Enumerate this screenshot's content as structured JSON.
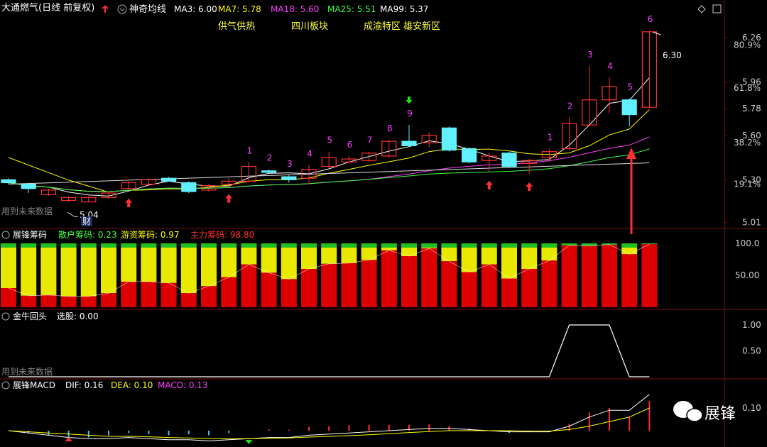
{
  "panel_main": {
    "stock_title": "大通燃气(日线 前复权)",
    "indicator_name": "神奇均线",
    "ma_labels": [
      {
        "label": "MA3: 6.00",
        "color": "#ffffff"
      },
      {
        "label": "MA7: 5.78",
        "color": "#ffff00"
      },
      {
        "label": "MA18: 5.60",
        "color": "#ff40ff"
      },
      {
        "label": "MA25: 5.51",
        "color": "#40ff40"
      },
      {
        "label": "MA99: 5.37",
        "color": "#ffffff"
      }
    ],
    "annotations": [
      "供气供热",
      "四川板块",
      "成渝特区 雄安新区"
    ],
    "future_note": "用到未来数据",
    "low_label": "5.04",
    "high_label": "6.30",
    "cai_label": "财",
    "price_ticks": [
      "6.26",
      "5.96",
      "5.78",
      "5.60",
      "5.30",
      "5.01"
    ],
    "pct_ticks": [
      "80.9%",
      "61.8%",
      "38.2%",
      "19.1%"
    ],
    "count_labels": [
      "1",
      "2",
      "3",
      "4",
      "5",
      "6",
      "7",
      "8",
      "9",
      "1",
      "2",
      "3",
      "4",
      "5",
      "6"
    ]
  },
  "panel_chip": {
    "name": "展锋筹码",
    "labels": [
      {
        "text": "散户筹码: 0.23",
        "color": "#40ff40"
      },
      {
        "text": "游资筹码: 0.97",
        "color": "#ffff00"
      },
      {
        "text": "主力筹码: 98.80",
        "color": "#ff3030"
      }
    ],
    "ticks": [
      "100.0",
      "50.00"
    ]
  },
  "panel_bull": {
    "name": "金牛回头",
    "label": "选股: 0.00",
    "note": "用到未来数据",
    "ticks": [
      "1.00",
      "0.50"
    ]
  },
  "panel_macd": {
    "name": "展锋MACD",
    "labels": [
      {
        "text": "DIF: 0.16",
        "color": "#ffffff"
      },
      {
        "text": "DEA: 0.10",
        "color": "#ffff00"
      },
      {
        "text": "MACD: 0.13",
        "color": "#ff40ff"
      }
    ],
    "ticks": [
      "0.10"
    ]
  },
  "watermark": "展锋",
  "colors": {
    "up": "#ff3030",
    "down": "#60f0ff",
    "green": "#40ff40",
    "yellow": "#ffff00",
    "magenta": "#ff40ff"
  },
  "chart_data": {
    "type": "candlestick",
    "candles": [
      {
        "open": 5.3,
        "close": 5.28,
        "high": 5.31,
        "low": 5.27
      },
      {
        "open": 5.27,
        "close": 5.24,
        "high": 5.28,
        "low": 5.21
      },
      {
        "open": 5.2,
        "close": 5.23,
        "high": 5.24,
        "low": 5.19
      },
      {
        "open": 5.16,
        "close": 5.18,
        "high": 5.19,
        "low": 5.15
      },
      {
        "open": 5.15,
        "close": 5.18,
        "high": 5.19,
        "low": 5.15
      },
      {
        "open": 5.18,
        "close": 5.21,
        "high": 5.22,
        "low": 5.17
      },
      {
        "open": 5.24,
        "close": 5.28,
        "high": 5.29,
        "low": 5.23
      },
      {
        "open": 5.27,
        "close": 5.3,
        "high": 5.31,
        "low": 5.26
      },
      {
        "open": 5.31,
        "close": 5.29,
        "high": 5.32,
        "low": 5.29
      },
      {
        "open": 5.28,
        "close": 5.22,
        "high": 5.29,
        "low": 5.21
      },
      {
        "open": 5.23,
        "close": 5.26,
        "high": 5.27,
        "low": 5.22
      },
      {
        "open": 5.27,
        "close": 5.29,
        "high": 5.31,
        "low": 5.26
      },
      {
        "open": 5.29,
        "close": 5.39,
        "high": 5.42,
        "low": 5.28
      },
      {
        "open": 5.36,
        "close": 5.35,
        "high": 5.37,
        "low": 5.34
      },
      {
        "open": 5.32,
        "close": 5.3,
        "high": 5.33,
        "low": 5.28
      },
      {
        "open": 5.31,
        "close": 5.37,
        "high": 5.4,
        "low": 5.27
      },
      {
        "open": 5.39,
        "close": 5.45,
        "high": 5.49,
        "low": 5.38
      },
      {
        "open": 5.42,
        "close": 5.44,
        "high": 5.46,
        "low": 5.41
      },
      {
        "open": 5.43,
        "close": 5.48,
        "high": 5.49,
        "low": 5.42
      },
      {
        "open": 5.46,
        "close": 5.56,
        "high": 5.57,
        "low": 5.45
      },
      {
        "open": 5.56,
        "close": 5.53,
        "high": 5.67,
        "low": 5.52
      },
      {
        "open": 5.55,
        "close": 5.6,
        "high": 5.62,
        "low": 5.52
      },
      {
        "open": 5.65,
        "close": 5.5,
        "high": 5.66,
        "low": 5.49
      },
      {
        "open": 5.51,
        "close": 5.42,
        "high": 5.52,
        "low": 5.41
      },
      {
        "open": 5.43,
        "close": 5.46,
        "high": 5.48,
        "low": 5.35
      },
      {
        "open": 5.48,
        "close": 5.39,
        "high": 5.49,
        "low": 5.38
      },
      {
        "open": 5.41,
        "close": 5.43,
        "high": 5.44,
        "low": 5.34
      },
      {
        "open": 5.45,
        "close": 5.49,
        "high": 5.51,
        "low": 5.42
      },
      {
        "open": 5.51,
        "close": 5.68,
        "high": 5.72,
        "low": 5.5
      },
      {
        "open": 5.67,
        "close": 5.84,
        "high": 6.07,
        "low": 5.66
      },
      {
        "open": 5.84,
        "close": 5.93,
        "high": 5.99,
        "low": 5.75
      },
      {
        "open": 5.84,
        "close": 5.74,
        "high": 5.85,
        "low": 5.66
      },
      {
        "open": 5.79,
        "close": 6.3,
        "high": 6.31,
        "low": 5.78
      }
    ],
    "chip_series": {
      "main": [
        30,
        18,
        19,
        17,
        17,
        22,
        40,
        40,
        38,
        22,
        33,
        47,
        67,
        54,
        44,
        60,
        68,
        69,
        74,
        89,
        80,
        92,
        72,
        55,
        67,
        45,
        60,
        73,
        97,
        96,
        98,
        83,
        98.8
      ],
      "retail_top": [
        100,
        100,
        100,
        100,
        100,
        100,
        100,
        100,
        100,
        100,
        100,
        100,
        100,
        100,
        100,
        100,
        100,
        100,
        100,
        100,
        100,
        100,
        100,
        100,
        100,
        100,
        100,
        100,
        100,
        100,
        100,
        100,
        100
      ]
    },
    "bull_signal": [
      0,
      0,
      0,
      0,
      0,
      0,
      0,
      0,
      0,
      0,
      0,
      0,
      0,
      0,
      0,
      0,
      0,
      0,
      0,
      0,
      0,
      0,
      0,
      0,
      0,
      0,
      0,
      0,
      1,
      1,
      1,
      0,
      0
    ],
    "macd": {
      "dif": [
        0.0,
        -0.01,
        -0.02,
        -0.03,
        -0.035,
        -0.035,
        -0.03,
        -0.035,
        -0.04,
        -0.04,
        -0.045,
        -0.04,
        -0.035,
        -0.03,
        -0.03,
        -0.02,
        -0.015,
        -0.01,
        -0.005,
        0.0,
        0.005,
        0.01,
        0.01,
        0.005,
        0.0,
        -0.005,
        -0.005,
        -0.005,
        0.02,
        0.06,
        0.09,
        0.09,
        0.16
      ],
      "dea": [
        0.0,
        -0.005,
        -0.01,
        -0.015,
        -0.02,
        -0.025,
        -0.025,
        -0.027,
        -0.03,
        -0.032,
        -0.035,
        -0.035,
        -0.035,
        -0.033,
        -0.032,
        -0.028,
        -0.025,
        -0.022,
        -0.018,
        -0.013,
        -0.008,
        -0.004,
        0.0,
        0.0,
        0.0,
        0.0,
        -0.002,
        -0.002,
        0.005,
        0.02,
        0.04,
        0.06,
        0.1
      ],
      "hist": [
        0.0,
        -0.01,
        -0.02,
        -0.03,
        -0.03,
        -0.02,
        -0.01,
        -0.016,
        -0.02,
        -0.016,
        -0.02,
        -0.01,
        0.0,
        0.006,
        0.004,
        0.016,
        0.02,
        0.024,
        0.026,
        0.026,
        0.026,
        0.028,
        0.02,
        0.01,
        0.0,
        -0.01,
        -0.006,
        -0.006,
        0.03,
        0.08,
        0.1,
        0.06,
        0.13
      ]
    }
  }
}
